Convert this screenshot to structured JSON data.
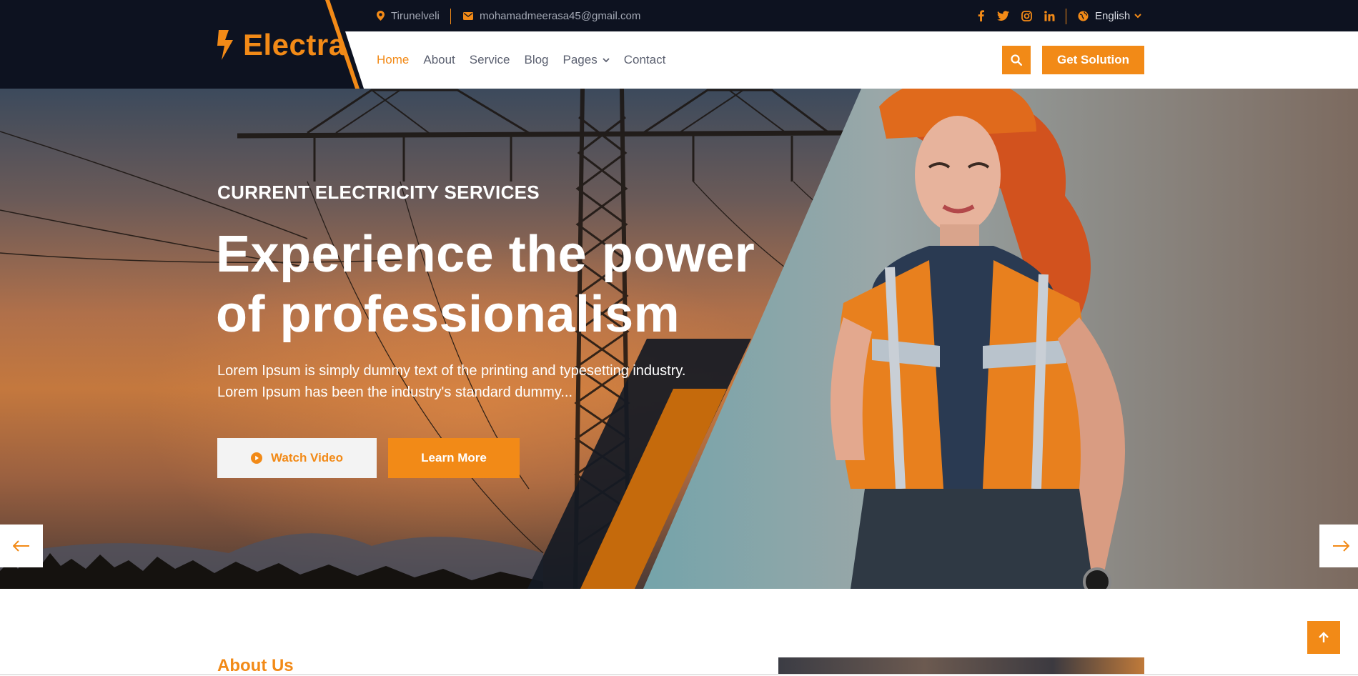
{
  "topbar": {
    "location": "Tirunelveli",
    "email": "mohamadmeerasa45@gmail.com",
    "socials": [
      "facebook-icon",
      "twitter-icon",
      "instagram-icon",
      "linkedin-icon"
    ],
    "language": "English"
  },
  "brand": {
    "name": "Electra",
    "accent": "#f28a17",
    "dark": "#0d1220"
  },
  "nav": {
    "items": [
      {
        "label": "Home",
        "active": true
      },
      {
        "label": "About"
      },
      {
        "label": "Service"
      },
      {
        "label": "Blog"
      },
      {
        "label": "Pages",
        "dropdown": true
      },
      {
        "label": "Contact"
      }
    ],
    "cta": "Get Solution"
  },
  "hero": {
    "kicker": "CURRENT ELECTRICITY SERVICES",
    "headline_line1": "Experience the power",
    "headline_line2": "of professionalism",
    "lead_line1": "Lorem Ipsum is simply dummy text of the printing and typesetting industry.",
    "lead_line2": "Lorem Ipsum has been the industry's standard dummy...",
    "watch_label": "Watch Video",
    "learn_label": "Learn More"
  },
  "about": {
    "title": "About Us"
  }
}
